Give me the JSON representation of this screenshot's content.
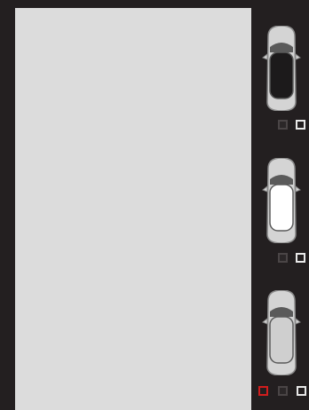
{
  "car_options": [
    {
      "name": "car-option-1",
      "window_tint": "dark",
      "roof_color": "#1c1a1b",
      "swatches": [
        "dark",
        "white"
      ]
    },
    {
      "name": "car-option-2",
      "window_tint": "white",
      "roof_color": "#ffffff",
      "swatches": [
        "dark",
        "white"
      ]
    },
    {
      "name": "car-option-3",
      "window_tint": "gray",
      "roof_color": "#cfcfcf",
      "swatches": [
        "red",
        "dark",
        "white"
      ]
    }
  ],
  "colors": {
    "background": "#231f20",
    "preview_panel": "#dcdcdc",
    "car_body": "#d4d4d4",
    "swatch_red": "#d11d1d",
    "swatch_dark": "#4a4546",
    "swatch_white": "#e8e8e8"
  }
}
